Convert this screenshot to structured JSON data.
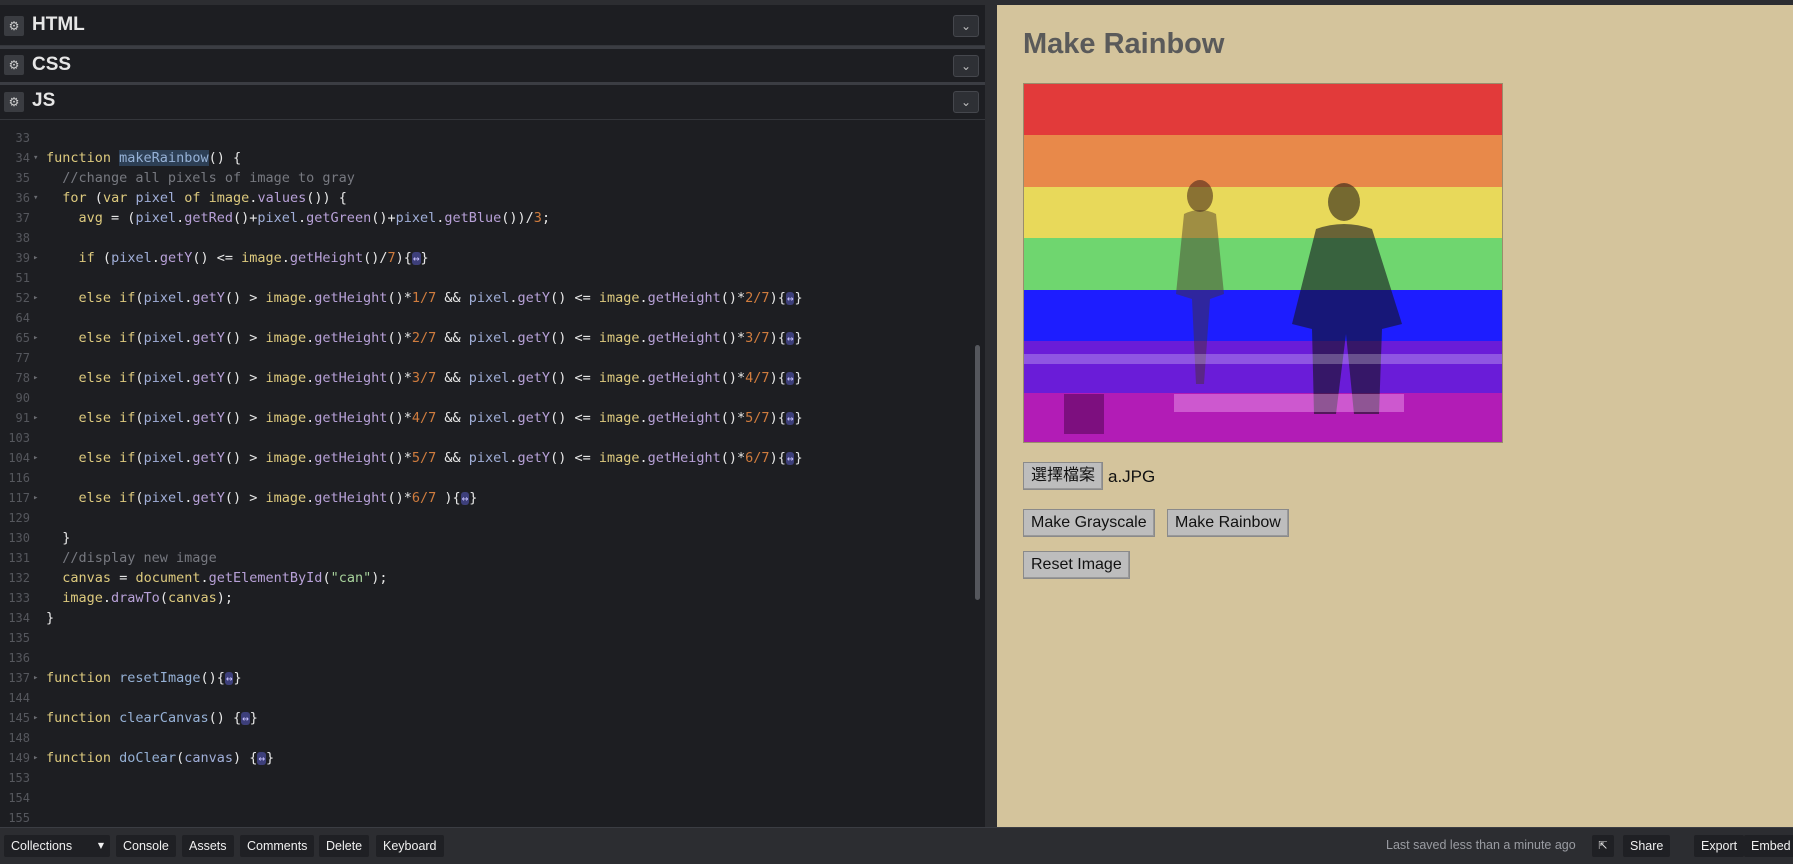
{
  "editor": {
    "panels": [
      {
        "title": "HTML"
      },
      {
        "title": "CSS"
      },
      {
        "title": "JS"
      }
    ]
  },
  "code_lines": [
    {
      "n": "33"
    },
    {
      "n": "34",
      "fold": "▾",
      "html": "<span class='kw'>function</span> <span class='fn hl'>makeRainbow</span><span class='op'>() {</span>"
    },
    {
      "n": "35",
      "html": "  <span class='cm'>//change all pixels of image to gray</span>"
    },
    {
      "n": "36",
      "fold": "▾",
      "html": "  <span class='kw'>for</span> <span class='op'>(</span><span class='kw'>var</span> <span class='var'>pixel</span> <span class='kw'>of</span> <span class='kw'>image</span><span class='op'>.</span><span class='mt'>values</span><span class='op'>()) {</span>"
    },
    {
      "n": "37",
      "html": "    <span class='kw'>avg</span> <span class='op'>= (</span><span class='var'>pixel</span><span class='op'>.</span><span class='mt'>getRed</span><span class='op'>()+</span><span class='var'>pixel</span><span class='op'>.</span><span class='mt'>getGreen</span><span class='op'>()+</span><span class='var'>pixel</span><span class='op'>.</span><span class='mt'>getBlue</span><span class='op'>())/</span><span class='num'>3</span><span class='op'>;</span>"
    },
    {
      "n": "38"
    },
    {
      "n": "39",
      "fold": "▸",
      "html": "    <span class='kw'>if</span> <span class='op'>(</span><span class='var'>pixel</span><span class='op'>.</span><span class='mt'>getY</span><span class='op'>() &lt;= </span><span class='kw'>image</span><span class='op'>.</span><span class='mt'>getHeight</span><span class='op'>()/</span><span class='num'>7</span><span class='op'>){</span><span class='ell'>↔</span><span class='op'>}</span>"
    },
    {
      "n": "51"
    },
    {
      "n": "52",
      "fold": "▸",
      "html": "    <span class='kw'>else if</span><span class='op'>(</span><span class='var'>pixel</span><span class='op'>.</span><span class='mt'>getY</span><span class='op'>() &gt; </span><span class='kw'>image</span><span class='op'>.</span><span class='mt'>getHeight</span><span class='op'>()*</span><span class='num'>1/7</span> <span class='op'>&amp;&amp;</span> <span class='var'>pixel</span><span class='op'>.</span><span class='mt'>getY</span><span class='op'>() &lt;= </span><span class='kw'>image</span><span class='op'>.</span><span class='mt'>getHeight</span><span class='op'>()*</span><span class='num'>2/7</span><span class='op'>){</span><span class='ell'>↔</span><span class='op'>}</span>"
    },
    {
      "n": "64"
    },
    {
      "n": "65",
      "fold": "▸",
      "html": "    <span class='kw'>else if</span><span class='op'>(</span><span class='var'>pixel</span><span class='op'>.</span><span class='mt'>getY</span><span class='op'>() &gt; </span><span class='kw'>image</span><span class='op'>.</span><span class='mt'>getHeight</span><span class='op'>()*</span><span class='num'>2/7</span> <span class='op'>&amp;&amp;</span> <span class='var'>pixel</span><span class='op'>.</span><span class='mt'>getY</span><span class='op'>() &lt;= </span><span class='kw'>image</span><span class='op'>.</span><span class='mt'>getHeight</span><span class='op'>()*</span><span class='num'>3/7</span><span class='op'>){</span><span class='ell'>↔</span><span class='op'>}</span>"
    },
    {
      "n": "77"
    },
    {
      "n": "78",
      "fold": "▸",
      "html": "    <span class='kw'>else if</span><span class='op'>(</span><span class='var'>pixel</span><span class='op'>.</span><span class='mt'>getY</span><span class='op'>() &gt; </span><span class='kw'>image</span><span class='op'>.</span><span class='mt'>getHeight</span><span class='op'>()*</span><span class='num'>3/7</span> <span class='op'>&amp;&amp;</span> <span class='var'>pixel</span><span class='op'>.</span><span class='mt'>getY</span><span class='op'>() &lt;= </span><span class='kw'>image</span><span class='op'>.</span><span class='mt'>getHeight</span><span class='op'>()*</span><span class='num'>4/7</span><span class='op'>){</span><span class='ell'>↔</span><span class='op'>}</span>"
    },
    {
      "n": "90"
    },
    {
      "n": "91",
      "fold": "▸",
      "html": "    <span class='kw'>else if</span><span class='op'>(</span><span class='var'>pixel</span><span class='op'>.</span><span class='mt'>getY</span><span class='op'>() &gt; </span><span class='kw'>image</span><span class='op'>.</span><span class='mt'>getHeight</span><span class='op'>()*</span><span class='num'>4/7</span> <span class='op'>&amp;&amp;</span> <span class='var'>pixel</span><span class='op'>.</span><span class='mt'>getY</span><span class='op'>() &lt;= </span><span class='kw'>image</span><span class='op'>.</span><span class='mt'>getHeight</span><span class='op'>()*</span><span class='num'>5/7</span><span class='op'>){</span><span class='ell'>↔</span><span class='op'>}</span>"
    },
    {
      "n": "103"
    },
    {
      "n": "104",
      "fold": "▸",
      "html": "    <span class='kw'>else if</span><span class='op'>(</span><span class='var'>pixel</span><span class='op'>.</span><span class='mt'>getY</span><span class='op'>() &gt; </span><span class='kw'>image</span><span class='op'>.</span><span class='mt'>getHeight</span><span class='op'>()*</span><span class='num'>5/7</span> <span class='op'>&amp;&amp;</span> <span class='var'>pixel</span><span class='op'>.</span><span class='mt'>getY</span><span class='op'>() &lt;= </span><span class='kw'>image</span><span class='op'>.</span><span class='mt'>getHeight</span><span class='op'>()*</span><span class='num'>6/7</span><span class='op'>){</span><span class='ell'>↔</span><span class='op'>}</span>"
    },
    {
      "n": "116"
    },
    {
      "n": "117",
      "fold": "▸",
      "html": "    <span class='kw'>else if</span><span class='op'>(</span><span class='var'>pixel</span><span class='op'>.</span><span class='mt'>getY</span><span class='op'>() &gt; </span><span class='kw'>image</span><span class='op'>.</span><span class='mt'>getHeight</span><span class='op'>()*</span><span class='num'>6/7</span> <span class='op'>){</span><span class='ell'>↔</span><span class='op'>}</span>"
    },
    {
      "n": "129"
    },
    {
      "n": "130",
      "html": "  <span class='op'>}</span>"
    },
    {
      "n": "131",
      "html": "  <span class='cm'>//display new image</span>"
    },
    {
      "n": "132",
      "html": "  <span class='kw'>canvas</span> <span class='op'>=</span> <span class='kw'>document</span><span class='op'>.</span><span class='mt'>getElementById</span><span class='op'>(</span><span class='str'>\"can\"</span><span class='op'>);</span>"
    },
    {
      "n": "133",
      "html": "  <span class='kw'>image</span><span class='op'>.</span><span class='mt'>drawTo</span><span class='op'>(</span><span class='kw'>canvas</span><span class='op'>);</span>"
    },
    {
      "n": "134",
      "html": "<span class='op'>}</span>"
    },
    {
      "n": "135"
    },
    {
      "n": "136"
    },
    {
      "n": "137",
      "fold": "▸",
      "html": "<span class='kw'>function</span> <span class='fn'>resetImage</span><span class='op'>(){</span><span class='ell'>↔</span><span class='op'>}</span>"
    },
    {
      "n": "144"
    },
    {
      "n": "145",
      "fold": "▸",
      "html": "<span class='kw'>function</span> <span class='fn'>clearCanvas</span><span class='op'>() {</span><span class='ell'>↔</span><span class='op'>}</span>"
    },
    {
      "n": "148"
    },
    {
      "n": "149",
      "fold": "▸",
      "html": "<span class='kw'>function</span> <span class='fn'>doClear</span><span class='op'>(</span><span class='var'>canvas</span><span class='op'>) {</span><span class='ell'>↔</span><span class='op'>}</span>"
    },
    {
      "n": "153"
    },
    {
      "n": "154"
    },
    {
      "n": "155"
    }
  ],
  "preview": {
    "title": "Make Rainbow",
    "file_button": "選擇檔案",
    "file_name": "a.JPG",
    "grayscale_button": "Make Grayscale",
    "rainbow_button": "Make Rainbow",
    "reset_button": "Reset Image",
    "band_colors": [
      "#e23a3a",
      "#e8894a",
      "#e8d95a",
      "#6fd66f",
      "#1d1dff",
      "#6a1cd8",
      "#b21cb6"
    ]
  },
  "footer": {
    "collections": "Collections",
    "console": "Console",
    "assets": "Assets",
    "comments": "Comments",
    "delete": "Delete",
    "keyboard": "Keyboard",
    "saved": "Last saved less than a minute ago",
    "share": "Share",
    "export": "Export",
    "embed": "Embed"
  }
}
